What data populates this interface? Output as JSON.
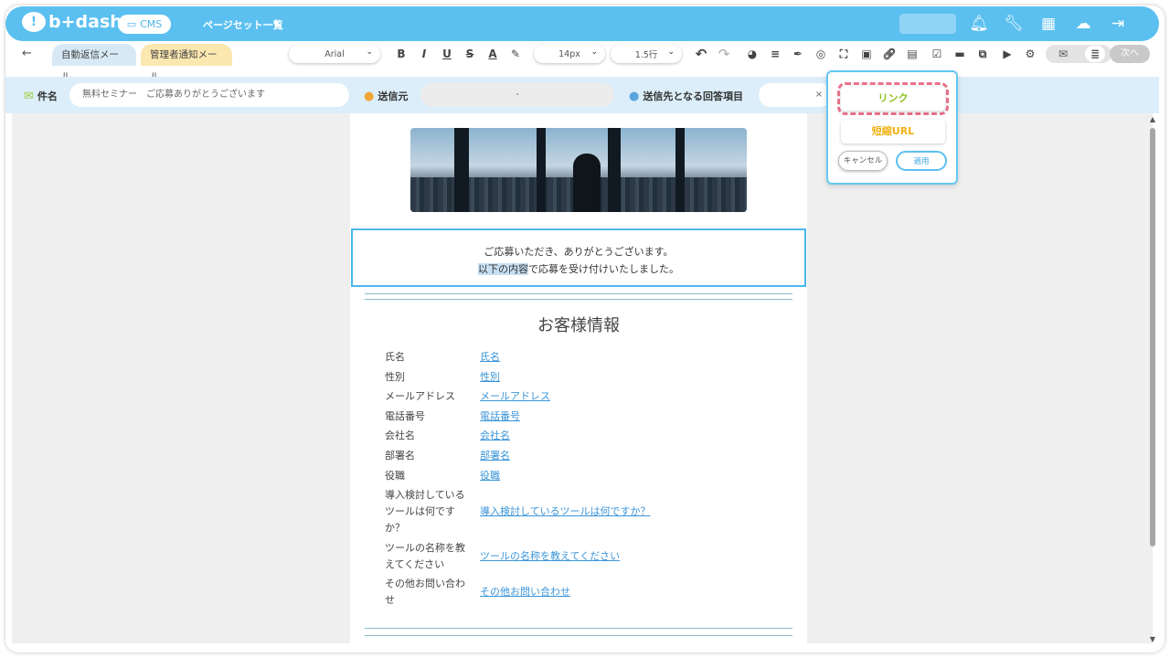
{
  "header": {
    "logo_text": "b+dash",
    "cms_label": "CMS",
    "page_title": "ページセット一覧"
  },
  "toolbar": {
    "back_icon": "back-arrow-icon",
    "tabs": [
      {
        "label": "自動返信メール"
      },
      {
        "label": "管理者通知メール"
      }
    ],
    "font_family": "Arial",
    "font_size": "14px",
    "line_height": "1.5行",
    "next_label": "次へ"
  },
  "fields": {
    "subject_label": "件名",
    "subject_value": "無料セミナー　ご応募ありがとうございます",
    "sender_label": "送信元",
    "sender_value": "-",
    "recipient_label": "送信先となる回答項目",
    "recipient_value": "×"
  },
  "email": {
    "message_line1": "ご応募いただき、ありがとうございます。",
    "message_line2_highlight": "以下の内容",
    "message_line2_rest": "で応募を受け付けいたしました。",
    "section_title": "お客様情報",
    "rows": [
      {
        "key": "氏名",
        "value": "氏名"
      },
      {
        "key": "性別",
        "value": "性別"
      },
      {
        "key": "メールアドレス",
        "value": "メールアドレス"
      },
      {
        "key": "電話番号",
        "value": "電話番号"
      },
      {
        "key": "会社名",
        "value": "会社名"
      },
      {
        "key": "部署名",
        "value": "部署名"
      },
      {
        "key": "役職",
        "value": "役職"
      },
      {
        "key": "導入検討している\nツールは何です\nか？",
        "value": "導入検討しているツールは何ですか？"
      },
      {
        "key": "ツールの名称を教\nえてください",
        "value": "ツールの名称を教えてください"
      },
      {
        "key": "その他お問い合わ\nせ",
        "value": "その他お問い合わせ"
      }
    ]
  },
  "popup": {
    "link_label": "リンク",
    "short_url_label": "短縮URL",
    "cancel_label": "キャンセル",
    "apply_label": "適用"
  },
  "colors": {
    "brand": "#5bc0f0",
    "link": "#3b95d9",
    "link_option": "#8cc11a",
    "short_url_option": "#f2b114",
    "highlight_dash": "#e8738a"
  }
}
